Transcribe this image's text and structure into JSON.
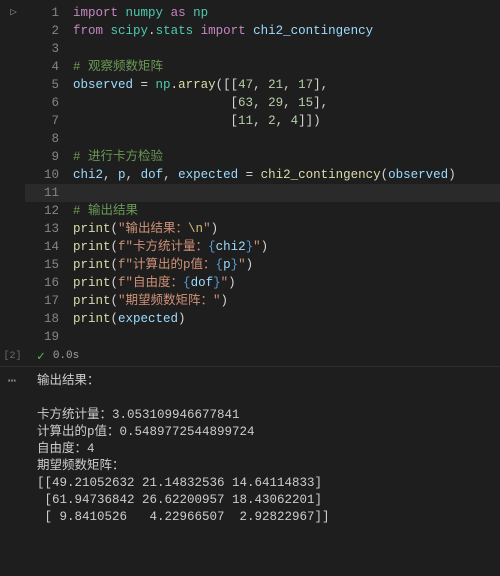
{
  "cell": {
    "run_icon": "▷",
    "exec_count_label": "[2]",
    "status_check": "✓",
    "status_time": "0.0s",
    "output_menu": "⋯"
  },
  "code": {
    "l1": {
      "kw1": "import",
      "mod": "numpy",
      "kw2": "as",
      "alias": "np"
    },
    "l2": {
      "kw1": "from",
      "mod": "scipy",
      "dot": ".",
      "sub": "stats",
      "kw2": "import",
      "name": "chi2_contingency"
    },
    "l4": {
      "comment": "# 观察频数矩阵"
    },
    "l5": {
      "lhs": "observed",
      "eq": " = ",
      "obj": "np",
      "dot": ".",
      "fn": "array",
      "open": "([[",
      "n1": "47",
      "c": ", ",
      "n2": "21",
      "n3": "17",
      "close": "],"
    },
    "l6": {
      "indent": "                     ",
      "open": "[",
      "n1": "63",
      "c": ", ",
      "n2": "29",
      "n3": "15",
      "close": "],"
    },
    "l7": {
      "indent": "                     ",
      "open": "[",
      "n1": "11",
      "c": ", ",
      "n2": "2",
      "n3": "4",
      "close": "]])"
    },
    "l9": {
      "comment": "# 进行卡方检验"
    },
    "l10": {
      "v1": "chi2",
      "c": ", ",
      "v2": "p",
      "v3": "dof",
      "v4": "expected",
      "eq": " = ",
      "fn": "chi2_contingency",
      "open": "(",
      "arg": "observed",
      "close": ")"
    },
    "l12": {
      "comment": "# 输出结果"
    },
    "l13": {
      "fn": "print",
      "open": "(",
      "str1": "\"输出结果：",
      "esc": "\\n",
      "str2": "\"",
      "close": ")"
    },
    "l14": {
      "fn": "print",
      "open": "(",
      "pfx": "f\"卡方统计量：",
      "lb": "{",
      "var": "chi2",
      "rb": "}",
      "sfx": "\"",
      "close": ")"
    },
    "l15": {
      "fn": "print",
      "open": "(",
      "pfx": "f\"计算出的p值：",
      "lb": "{",
      "var": "p",
      "rb": "}",
      "sfx": "\"",
      "close": ")"
    },
    "l16": {
      "fn": "print",
      "open": "(",
      "pfx": "f\"自由度：",
      "lb": "{",
      "var": "dof",
      "rb": "}",
      "sfx": "\"",
      "close": ")"
    },
    "l17": {
      "fn": "print",
      "open": "(",
      "str": "\"期望频数矩阵：\"",
      "close": ")"
    },
    "l18": {
      "fn": "print",
      "open": "(",
      "arg": "expected",
      "close": ")"
    }
  },
  "linenos": {
    "n1": "1",
    "n2": "2",
    "n3": "3",
    "n4": "4",
    "n5": "5",
    "n6": "6",
    "n7": "7",
    "n8": "8",
    "n9": "9",
    "n10": "10",
    "n11": "11",
    "n12": "12",
    "n13": "13",
    "n14": "14",
    "n15": "15",
    "n16": "16",
    "n17": "17",
    "n18": "18",
    "n19": "19"
  },
  "output": {
    "line1": "输出结果：",
    "blank": "",
    "line2": "卡方统计量：3.053109946677841",
    "line3": "计算出的p值：0.5489772544899724",
    "line4": "自由度：4",
    "line5": "期望频数矩阵：",
    "line6": "[[49.21052632 21.14832536 14.64114833]",
    "line7": " [61.94736842 26.62200957 18.43062201]",
    "line8": " [ 9.8410526   4.22966507  2.92822967]]"
  }
}
